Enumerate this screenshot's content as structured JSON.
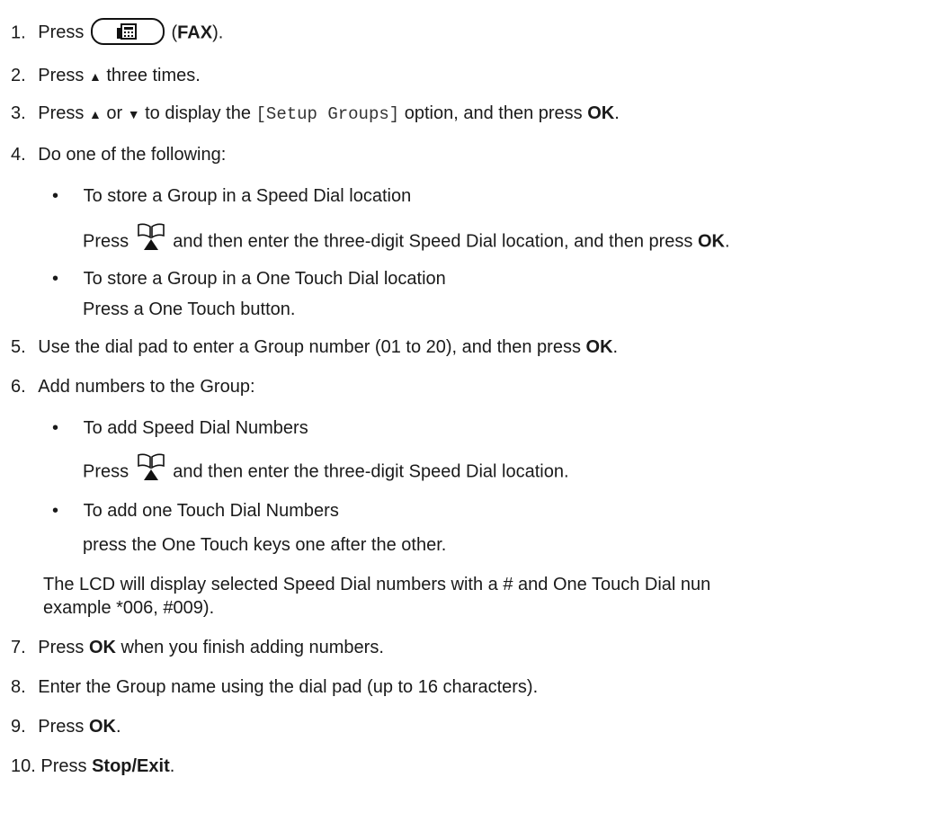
{
  "steps": [
    {
      "num": "1.",
      "press": "Press",
      "fax_label": "FAX",
      "post": "."
    },
    {
      "num": "2.",
      "pre": "Press ",
      "tri": "▲",
      "post": " three times."
    },
    {
      "num": "3.",
      "pre": "Press ",
      "up": "▲",
      "or": " or ",
      "down": "▼",
      "mid": " to display the ",
      "code": "[Setup Groups]",
      "post": " option, and then press ",
      "ok": "OK",
      "end": "."
    },
    {
      "num": "4.",
      "text": "Do one of the following:",
      "bullets": [
        {
          "title": "To store a Group in a Speed Dial location",
          "pre": "Press",
          "post": " and then enter the three-digit Speed Dial location, and then press ",
          "ok": "OK",
          "end": "."
        },
        {
          "title": "To store a Group in a One Touch Dial location",
          "text": "Press a One Touch button."
        }
      ]
    },
    {
      "num": "5.",
      "pre": "Use the dial pad to enter a Group number (01 to 20), and then press ",
      "ok": "OK",
      "end": "."
    },
    {
      "num": "6.",
      "text": "Add numbers to the Group:",
      "bullets": [
        {
          "title": "To add Speed Dial Numbers",
          "pre": "Press",
          "post": " and then enter the three-digit Speed Dial location."
        },
        {
          "title": "To add one Touch Dial Numbers",
          "text": "press the One Touch keys one after the other."
        }
      ],
      "note_line1": "The LCD will display selected Speed Dial numbers with a # and One Touch Dial nun",
      "note_line2": "example *006, #009)."
    },
    {
      "num": "7.",
      "pre": "Press ",
      "ok": "OK",
      "post": " when you finish adding numbers."
    },
    {
      "num": "8.",
      "text": "Enter the Group name using the dial pad (up to 16 characters)."
    },
    {
      "num": "9.",
      "pre": "Press ",
      "ok": "OK",
      "end": "."
    },
    {
      "num": "10.",
      "pre": "Press ",
      "bold": "Stop/Exit",
      "end": "."
    }
  ],
  "bullet_char": "•",
  "icons": {
    "fax": "fax-icon",
    "book": "address-book-icon"
  }
}
